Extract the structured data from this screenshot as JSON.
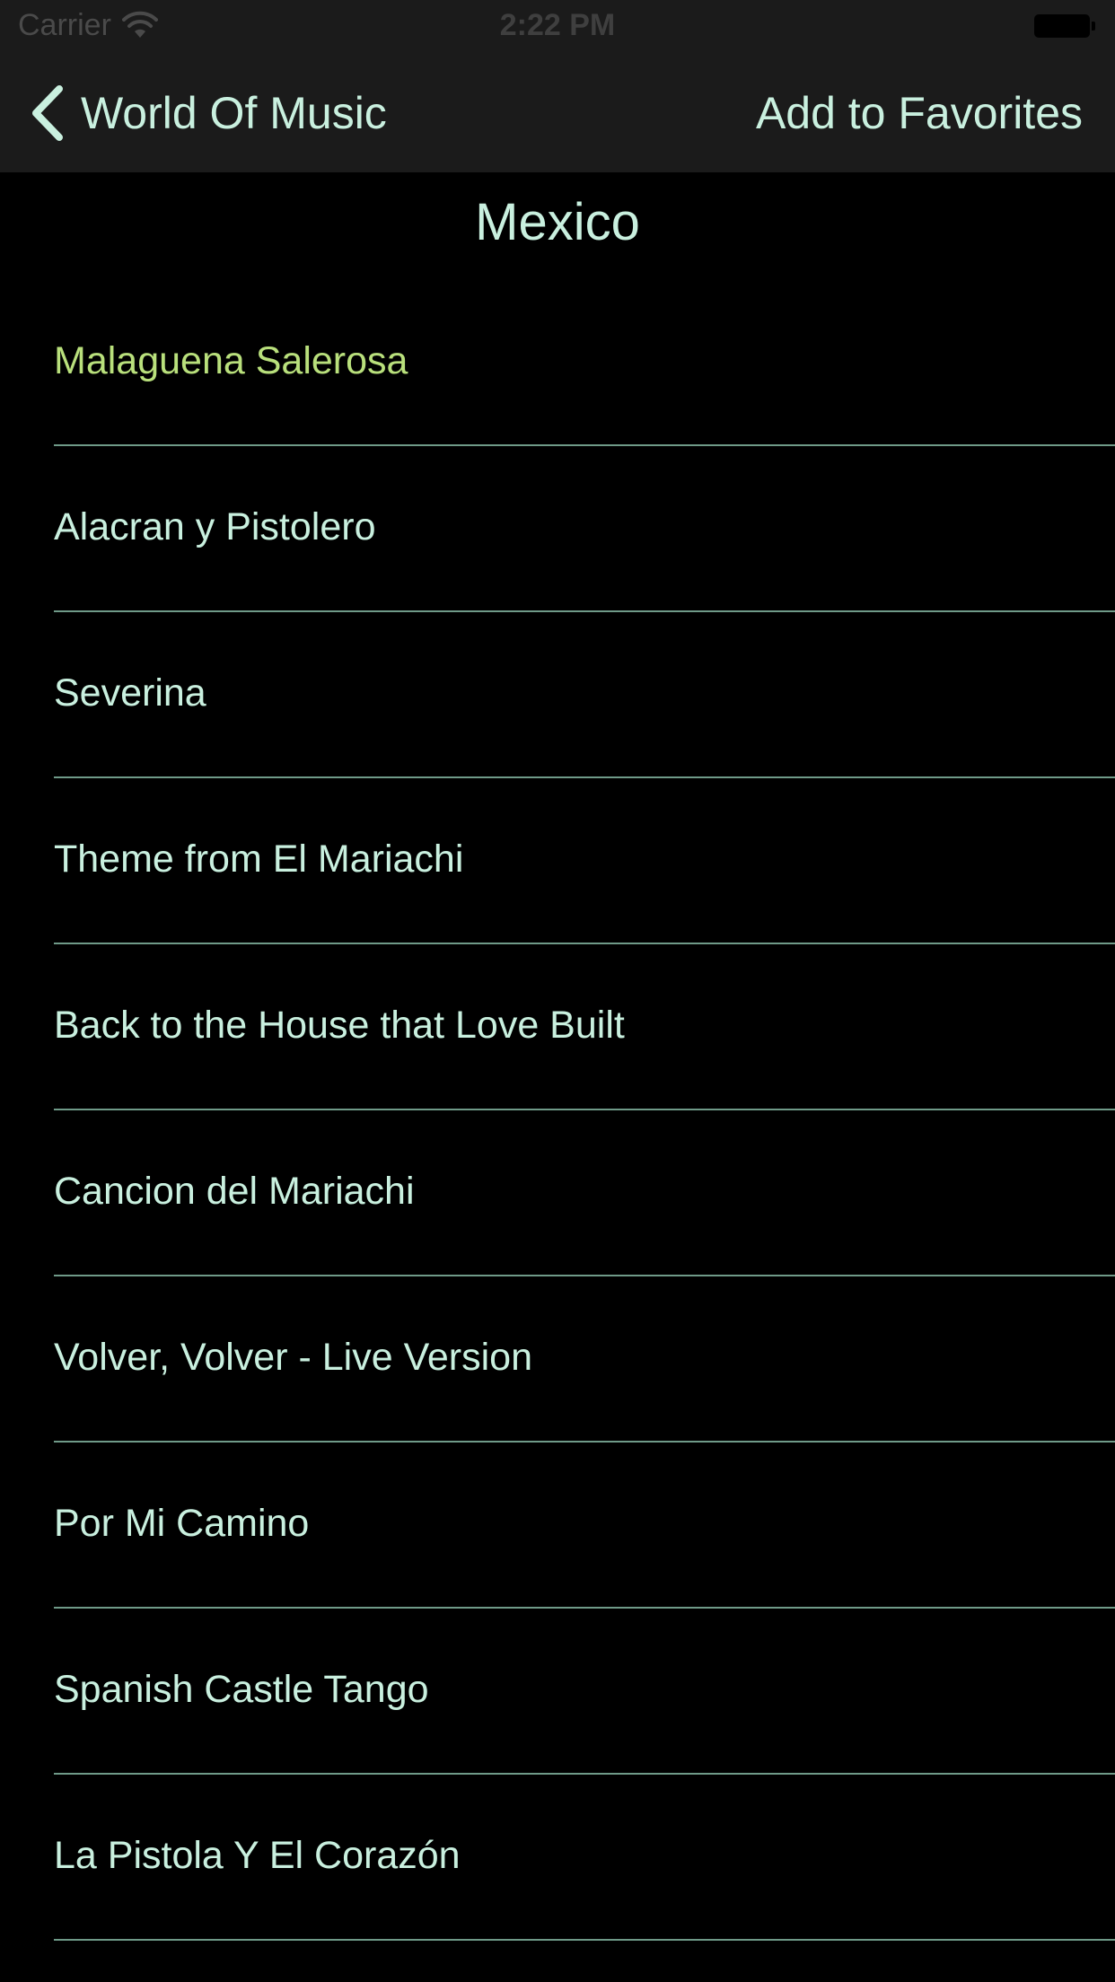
{
  "status_bar": {
    "carrier": "Carrier",
    "time": "2:22 PM",
    "wifi_icon": "wifi-icon",
    "battery_icon": "battery-icon"
  },
  "nav_bar": {
    "back_label": "World Of Music",
    "back_icon": "chevron-left-icon",
    "action_label": "Add to Favorites"
  },
  "page": {
    "title": "Mexico"
  },
  "songs": [
    {
      "title": "Malaguena Salerosa",
      "selected": true
    },
    {
      "title": "Alacran y Pistolero"
    },
    {
      "title": "Severina"
    },
    {
      "title": "Theme from El Mariachi"
    },
    {
      "title": "Back to the House that Love Built"
    },
    {
      "title": "Cancion del Mariachi"
    },
    {
      "title": "Volver, Volver - Live Version"
    },
    {
      "title": "Por Mi Camino"
    },
    {
      "title": "Spanish Castle Tango"
    },
    {
      "title": "La Pistola Y El Corazón"
    }
  ],
  "colors": {
    "background": "#000000",
    "bar_background": "#1b1b1b",
    "text": "#c9f0df",
    "selected_text": "#b9e07c",
    "separator": "#6f9a88"
  }
}
